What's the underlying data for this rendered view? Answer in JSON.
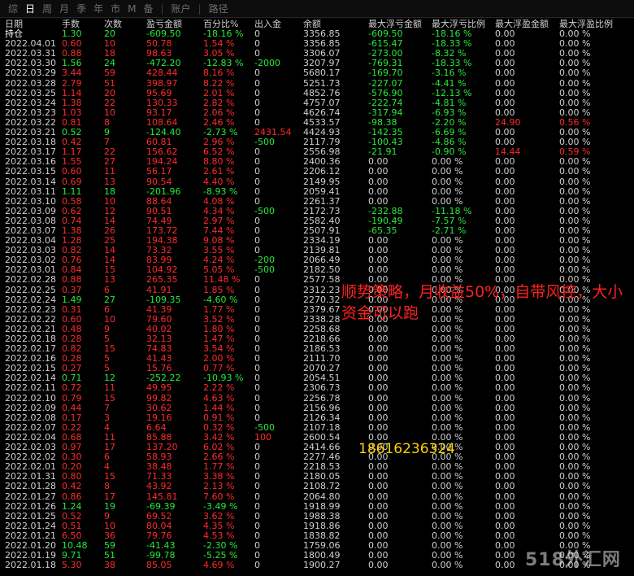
{
  "tabs": [
    {
      "label": "综",
      "active": false
    },
    {
      "label": "日",
      "active": true
    },
    {
      "label": "周",
      "active": false
    },
    {
      "label": "月",
      "active": false
    },
    {
      "label": "季",
      "active": false
    },
    {
      "label": "年",
      "active": false
    },
    {
      "label": "市",
      "active": false
    },
    {
      "label": "M",
      "active": false
    },
    {
      "label": "备",
      "active": false
    },
    {
      "label": "账户",
      "active": false
    },
    {
      "label": "路径",
      "active": false
    }
  ],
  "headers": [
    "日期",
    "手数",
    "次数",
    "盈亏金额",
    "百分比%",
    "出入金",
    "余额",
    "最大浮亏金额",
    "最大浮亏比例",
    "最大浮盈金额",
    "最大浮盈比例"
  ],
  "rows": [
    [
      "持仓",
      "1.30",
      "20",
      "-609.50",
      "-18.16 %",
      "0",
      "3356.85",
      "-609.50",
      "-18.16 %",
      "0.00",
      "0.00 %"
    ],
    [
      "2022.04.01",
      "0.60",
      "10",
      "50.78",
      "1.54 %",
      "0",
      "3356.85",
      "-615.47",
      "-18.33 %",
      "0.00",
      "0.00 %"
    ],
    [
      "2022.03.31",
      "0.88",
      "18",
      "98.63",
      "3.05 %",
      "0",
      "3306.07",
      "-273.00",
      "-8.32 %",
      "0.00",
      "0.00 %"
    ],
    [
      "2022.03.30",
      "1.56",
      "24",
      "-472.20",
      "-12.83 %",
      "-2000",
      "3207.97",
      "-769.31",
      "-18.33 %",
      "0.00",
      "0.00 %"
    ],
    [
      "2022.03.29",
      "3.44",
      "59",
      "428.44",
      "8.16 %",
      "0",
      "5680.17",
      "-169.70",
      "-3.16 %",
      "0.00",
      "0.00 %"
    ],
    [
      "2022.03.28",
      "2.79",
      "51",
      "398.97",
      "8.22 %",
      "0",
      "5251.73",
      "-227.07",
      "-4.41 %",
      "0.00",
      "0.00 %"
    ],
    [
      "2022.03.25",
      "1.14",
      "20",
      "95.69",
      "2.01 %",
      "0",
      "4852.76",
      "-576.90",
      "-12.13 %",
      "0.00",
      "0.00 %"
    ],
    [
      "2022.03.24",
      "1.38",
      "22",
      "130.33",
      "2.82 %",
      "0",
      "4757.07",
      "-222.74",
      "-4.81 %",
      "0.00",
      "0.00 %"
    ],
    [
      "2022.03.23",
      "1.03",
      "10",
      "93.17",
      "2.06 %",
      "0",
      "4626.74",
      "-317.94",
      "-6.93 %",
      "0.00",
      "0.00 %"
    ],
    [
      "2022.03.22",
      "0.81",
      "8",
      "108.64",
      "2.46 %",
      "0",
      "4533.57",
      "-98.38",
      "-2.20 %",
      "24.90",
      "0.56 %"
    ],
    [
      "2022.03.21",
      "0.52",
      "9",
      "-124.40",
      "-2.73 %",
      "2431.54",
      "4424.93",
      "-142.35",
      "-6.69 %",
      "0.00",
      "0.00 %"
    ],
    [
      "2022.03.18",
      "0.42",
      "7",
      "60.81",
      "2.96 %",
      "-500",
      "2117.79",
      "-100.43",
      "-4.86 %",
      "0.00",
      "0.00 %"
    ],
    [
      "2022.03.17",
      "1.17",
      "22",
      "156.62",
      "6.52 %",
      "0",
      "2556.98",
      "-21.91",
      "-0.90 %",
      "14.44",
      "0.59 %"
    ],
    [
      "2022.03.16",
      "1.55",
      "27",
      "194.24",
      "8.80 %",
      "0",
      "2400.36",
      "0.00",
      "0.00 %",
      "0.00",
      "0.00 %"
    ],
    [
      "2022.03.15",
      "0.60",
      "11",
      "56.17",
      "2.61 %",
      "0",
      "2206.12",
      "0.00",
      "0.00 %",
      "0.00",
      "0.00 %"
    ],
    [
      "2022.03.14",
      "0.69",
      "13",
      "90.54",
      "4.40 %",
      "0",
      "2149.95",
      "0.00",
      "0.00 %",
      "0.00",
      "0.00 %"
    ],
    [
      "2022.03.11",
      "1.11",
      "18",
      "-201.96",
      "-8.93 %",
      "0",
      "2059.41",
      "0.00",
      "0.00 %",
      "0.00",
      "0.00 %"
    ],
    [
      "2022.03.10",
      "0.58",
      "10",
      "88.64",
      "4.08 %",
      "0",
      "2261.37",
      "0.00",
      "0.00 %",
      "0.00",
      "0.00 %"
    ],
    [
      "2022.03.09",
      "0.62",
      "12",
      "90.51",
      "4.34 %",
      "-500",
      "2172.73",
      "-232.88",
      "-11.18 %",
      "0.00",
      "0.00 %"
    ],
    [
      "2022.03.08",
      "0.74",
      "14",
      "74.49",
      "2.97 %",
      "0",
      "2582.40",
      "-190.49",
      "-7.57 %",
      "0.00",
      "0.00 %"
    ],
    [
      "2022.03.07",
      "1.38",
      "26",
      "173.72",
      "7.44 %",
      "0",
      "2507.91",
      "-65.35",
      "-2.71 %",
      "0.00",
      "0.00 %"
    ],
    [
      "2022.03.04",
      "1.28",
      "25",
      "194.38",
      "9.08 %",
      "0",
      "2334.19",
      "0.00",
      "0.00 %",
      "0.00",
      "0.00 %"
    ],
    [
      "2022.03.03",
      "0.82",
      "14",
      "73.32",
      "3.55 %",
      "0",
      "2139.81",
      "0.00",
      "0.00 %",
      "0.00",
      "0.00 %"
    ],
    [
      "2022.03.02",
      "0.76",
      "14",
      "83.99",
      "4.24 %",
      "-200",
      "2066.49",
      "0.00",
      "0.00 %",
      "0.00",
      "0.00 %"
    ],
    [
      "2022.03.01",
      "0.84",
      "15",
      "104.92",
      "5.05 %",
      "-500",
      "2182.50",
      "0.00",
      "0.00 %",
      "0.00",
      "0.00 %"
    ],
    [
      "2022.02.28",
      "0.88",
      "13",
      "265.35",
      "11.48 %",
      "0",
      "2577.58",
      "0.00",
      "0.00 %",
      "0.00",
      "0.00 %"
    ],
    [
      "2022.02.25",
      "0.37",
      "6",
      "41.91",
      "1.85 %",
      "0",
      "2312.23",
      "0.00",
      "0.00 %",
      "0.00",
      "0.00 %"
    ],
    [
      "2022.02.24",
      "1.49",
      "27",
      "-109.35",
      "-4.60 %",
      "0",
      "2270.32",
      "0.00",
      "0.00 %",
      "0.00",
      "0.00 %"
    ],
    [
      "2022.02.23",
      "0.31",
      "6",
      "41.39",
      "1.77 %",
      "0",
      "2379.67",
      "0.00",
      "0.00 %",
      "0.00",
      "0.00 %"
    ],
    [
      "2022.02.22",
      "0.60",
      "10",
      "79.60",
      "3.52 %",
      "0",
      "2338.28",
      "0.00",
      "0.00 %",
      "0.00",
      "0.00 %"
    ],
    [
      "2022.02.21",
      "0.48",
      "9",
      "40.02",
      "1.80 %",
      "0",
      "2258.68",
      "0.00",
      "0.00 %",
      "0.00",
      "0.00 %"
    ],
    [
      "2022.02.18",
      "0.28",
      "5",
      "32.13",
      "1.47 %",
      "0",
      "2218.66",
      "0.00",
      "0.00 %",
      "0.00",
      "0.00 %"
    ],
    [
      "2022.02.17",
      "0.82",
      "15",
      "74.83",
      "3.54 %",
      "0",
      "2186.53",
      "0.00",
      "0.00 %",
      "0.00",
      "0.00 %"
    ],
    [
      "2022.02.16",
      "0.28",
      "5",
      "41.43",
      "2.00 %",
      "0",
      "2111.70",
      "0.00",
      "0.00 %",
      "0.00",
      "0.00 %"
    ],
    [
      "2022.02.15",
      "0.27",
      "5",
      "15.76",
      "0.77 %",
      "0",
      "2070.27",
      "0.00",
      "0.00 %",
      "0.00",
      "0.00 %"
    ],
    [
      "2022.02.14",
      "0.71",
      "12",
      "-252.22",
      "-10.93 %",
      "0",
      "2054.51",
      "0.00",
      "0.00 %",
      "0.00",
      "0.00 %"
    ],
    [
      "2022.02.11",
      "0.72",
      "11",
      "49.95",
      "2.22 %",
      "0",
      "2306.73",
      "0.00",
      "0.00 %",
      "0.00",
      "0.00 %"
    ],
    [
      "2022.02.10",
      "0.79",
      "15",
      "99.82",
      "4.63 %",
      "0",
      "2256.78",
      "0.00",
      "0.00 %",
      "0.00",
      "0.00 %"
    ],
    [
      "2022.02.09",
      "0.44",
      "7",
      "30.62",
      "1.44 %",
      "0",
      "2156.96",
      "0.00",
      "0.00 %",
      "0.00",
      "0.00 %"
    ],
    [
      "2022.02.08",
      "0.17",
      "3",
      "19.16",
      "0.91 %",
      "0",
      "2126.34",
      "0.00",
      "0.00 %",
      "0.00",
      "0.00 %"
    ],
    [
      "2022.02.07",
      "0.22",
      "4",
      "6.64",
      "0.32 %",
      "-500",
      "2107.18",
      "0.00",
      "0.00 %",
      "0.00",
      "0.00 %"
    ],
    [
      "2022.02.04",
      "0.68",
      "11",
      "85.88",
      "3.42 %",
      "100",
      "2600.54",
      "0.00",
      "0.00 %",
      "0.00",
      "0.00 %"
    ],
    [
      "2022.02.03",
      "0.97",
      "17",
      "137.20",
      "6.02 %",
      "0",
      "2414.66",
      "0.00",
      "0.00 %",
      "0.00",
      "0.00 %"
    ],
    [
      "2022.02.02",
      "0.30",
      "6",
      "58.93",
      "2.66 %",
      "0",
      "2277.46",
      "0.00",
      "0.00 %",
      "0.00",
      "0.00 %"
    ],
    [
      "2022.02.01",
      "0.20",
      "4",
      "38.48",
      "1.77 %",
      "0",
      "2218.53",
      "0.00",
      "0.00 %",
      "0.00",
      "0.00 %"
    ],
    [
      "2022.01.31",
      "0.80",
      "15",
      "71.33",
      "3.38 %",
      "0",
      "2180.05",
      "0.00",
      "0.00 %",
      "0.00",
      "0.00 %"
    ],
    [
      "2022.01.28",
      "0.42",
      "8",
      "43.92",
      "2.13 %",
      "0",
      "2108.72",
      "0.00",
      "0.00 %",
      "0.00",
      "0.00 %"
    ],
    [
      "2022.01.27",
      "0.86",
      "17",
      "145.81",
      "7.60 %",
      "0",
      "2064.80",
      "0.00",
      "0.00 %",
      "0.00",
      "0.00 %"
    ],
    [
      "2022.01.26",
      "1.24",
      "19",
      "-69.39",
      "-3.49 %",
      "0",
      "1918.99",
      "0.00",
      "0.00 %",
      "0.00",
      "0.00 %"
    ],
    [
      "2022.01.25",
      "0.52",
      "9",
      "69.52",
      "3.62 %",
      "0",
      "1988.38",
      "0.00",
      "0.00 %",
      "0.00",
      "0.00 %"
    ],
    [
      "2022.01.24",
      "0.51",
      "10",
      "80.04",
      "4.35 %",
      "0",
      "1918.86",
      "0.00",
      "0.00 %",
      "0.00",
      "0.00 %"
    ],
    [
      "2022.01.21",
      "6.50",
      "36",
      "79.76",
      "4.53 %",
      "0",
      "1838.82",
      "0.00",
      "0.00 %",
      "0.00",
      "0.00 %"
    ],
    [
      "2022.01.20",
      "10.48",
      "59",
      "-41.43",
      "-2.30 %",
      "0",
      "1759.06",
      "0.00",
      "0.00 %",
      "0.00",
      "0.00 %"
    ],
    [
      "2022.01.19",
      "9.71",
      "51",
      "-99.78",
      "-5.25 %",
      "0",
      "1800.49",
      "0.00",
      "0.00 %",
      "0.00",
      "0.00 %"
    ],
    [
      "2022.01.18",
      "5.30",
      "38",
      "85.05",
      "4.69 %",
      "0",
      "1900.27",
      "0.00",
      "0.00 %",
      "0.00",
      "0.00 %"
    ]
  ],
  "overlay": {
    "ad_text": "顺势策略，月收益50%，自带风控，大小资金可以跑",
    "phone": "18616236324",
    "watermark": "518外汇网"
  },
  "colors": {
    "positive": "#ff2b2b",
    "negative": "#28e83a",
    "neutral": "#d0d0d0",
    "background": "#000000",
    "ad": "#ff2020",
    "phone": "#ffd000"
  }
}
